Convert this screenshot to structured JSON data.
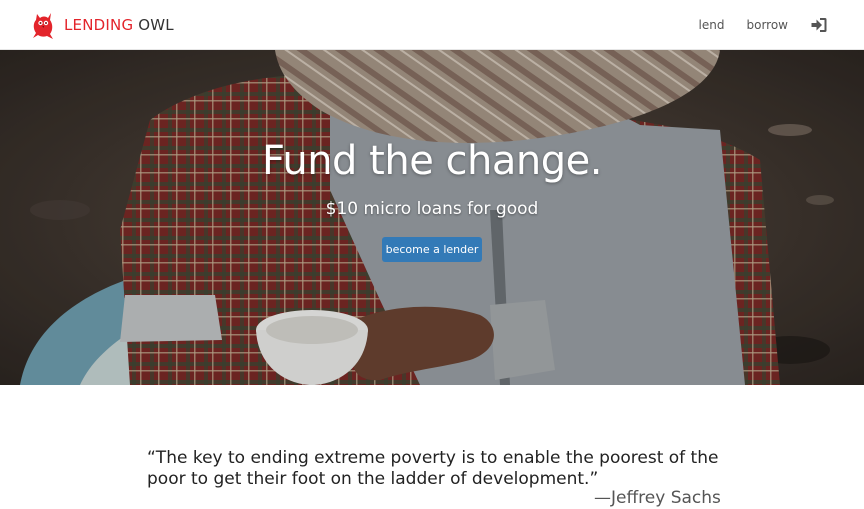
{
  "navbar": {
    "brand_accent": "LENDING",
    "brand_rest": " OWL",
    "logo_icon": "owl-logo-icon",
    "links": [
      "lend",
      "borrow"
    ],
    "login_icon": "sign-in-icon"
  },
  "hero": {
    "title": "Fund the change.",
    "subtitle": "$10 micro loans for good",
    "cta_label": "become a lender"
  },
  "quote": {
    "text": "“The key to ending extreme poverty is to enable the poorest of the poor to get their foot on the ladder of development.”",
    "author": "—Jeffrey Sachs"
  },
  "colors": {
    "brand_red": "#e3242b",
    "primary_button": "#337ab7",
    "text_dark": "#222222"
  }
}
